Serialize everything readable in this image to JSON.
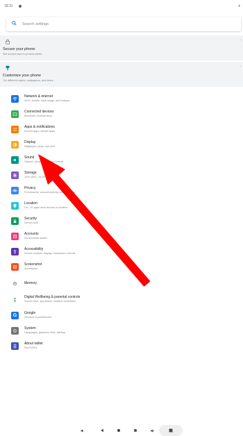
{
  "status": {
    "time": "18:31"
  },
  "search": {
    "placeholder": "Search settings"
  },
  "cards": [
    {
      "title": "Secure your phone",
      "subtitle": "Set screen lock to protect tablet",
      "icon": "lock-icon"
    },
    {
      "title": "Customize your phone",
      "subtitle": "Try different styles, wallpapers, and more",
      "icon": "brush-icon"
    }
  ],
  "settings": [
    {
      "title": "Network & internet",
      "subtitle": "Wi-Fi, mobile, data usage, and hotspot",
      "icon": "wifi-icon",
      "color": "#1a73e8"
    },
    {
      "title": "Connected devices",
      "subtitle": "Bluetooth, Android Auto",
      "icon": "devices-icon",
      "color": "#34a853"
    },
    {
      "title": "Apps & notifications",
      "subtitle": "Recent apps, default apps",
      "icon": "apps-icon",
      "color": "#f57c00"
    },
    {
      "title": "Display",
      "subtitle": "Wallpaper, sleep, font size",
      "icon": "display-icon",
      "color": "#f9a825"
    },
    {
      "title": "Sound",
      "subtitle": "Volume, vibration, Do Not Disturb",
      "icon": "sound-icon",
      "color": "#009688"
    },
    {
      "title": "Storage",
      "subtitle": "23% used - 24.59 GB free",
      "icon": "storage-icon",
      "color": "#7e57c2"
    },
    {
      "title": "Privacy",
      "subtitle": "Permissions, account activity, personal data",
      "icon": "privacy-icon",
      "color": "#4285f4"
    },
    {
      "title": "Location",
      "subtitle": "On - 10 apps have access to location",
      "icon": "location-icon",
      "color": "#26c6da"
    },
    {
      "title": "Security",
      "subtitle": "Screen lock",
      "icon": "security-icon",
      "color": "#0f9d58"
    },
    {
      "title": "Accounts",
      "subtitle": "No accounts added",
      "icon": "accounts-icon",
      "color": "#ec407a"
    },
    {
      "title": "Accessibility",
      "subtitle": "Screen readers, display, interaction controls",
      "icon": "accessibility-icon",
      "color": "#5e35b1"
    },
    {
      "title": "Screenshot",
      "subtitle": "Screenshot",
      "icon": "screenshot-icon",
      "color": "#f4511e"
    },
    {
      "title": "Memory",
      "subtitle": "",
      "icon": "memory-icon",
      "color": "#5f6368"
    },
    {
      "title": "Digital Wellbeing & parental controls",
      "subtitle": "Screen time, app timers, bedtime schedules",
      "icon": "wellbeing-icon",
      "color": "#34a853"
    },
    {
      "title": "Google",
      "subtitle": "Services & preferences",
      "icon": "google-icon",
      "color": "#1a73e8"
    },
    {
      "title": "System",
      "subtitle": "Languages, gestures, time, backup",
      "icon": "system-icon",
      "color": "#757575"
    },
    {
      "title": "About tablet",
      "subtitle": "RsuT200G",
      "icon": "about-icon",
      "color": "#3f51b5"
    }
  ],
  "nav": [
    "volume-down-icon",
    "back-icon",
    "home-icon",
    "recents-icon",
    "volume-up-icon",
    "screenshot-icon"
  ]
}
